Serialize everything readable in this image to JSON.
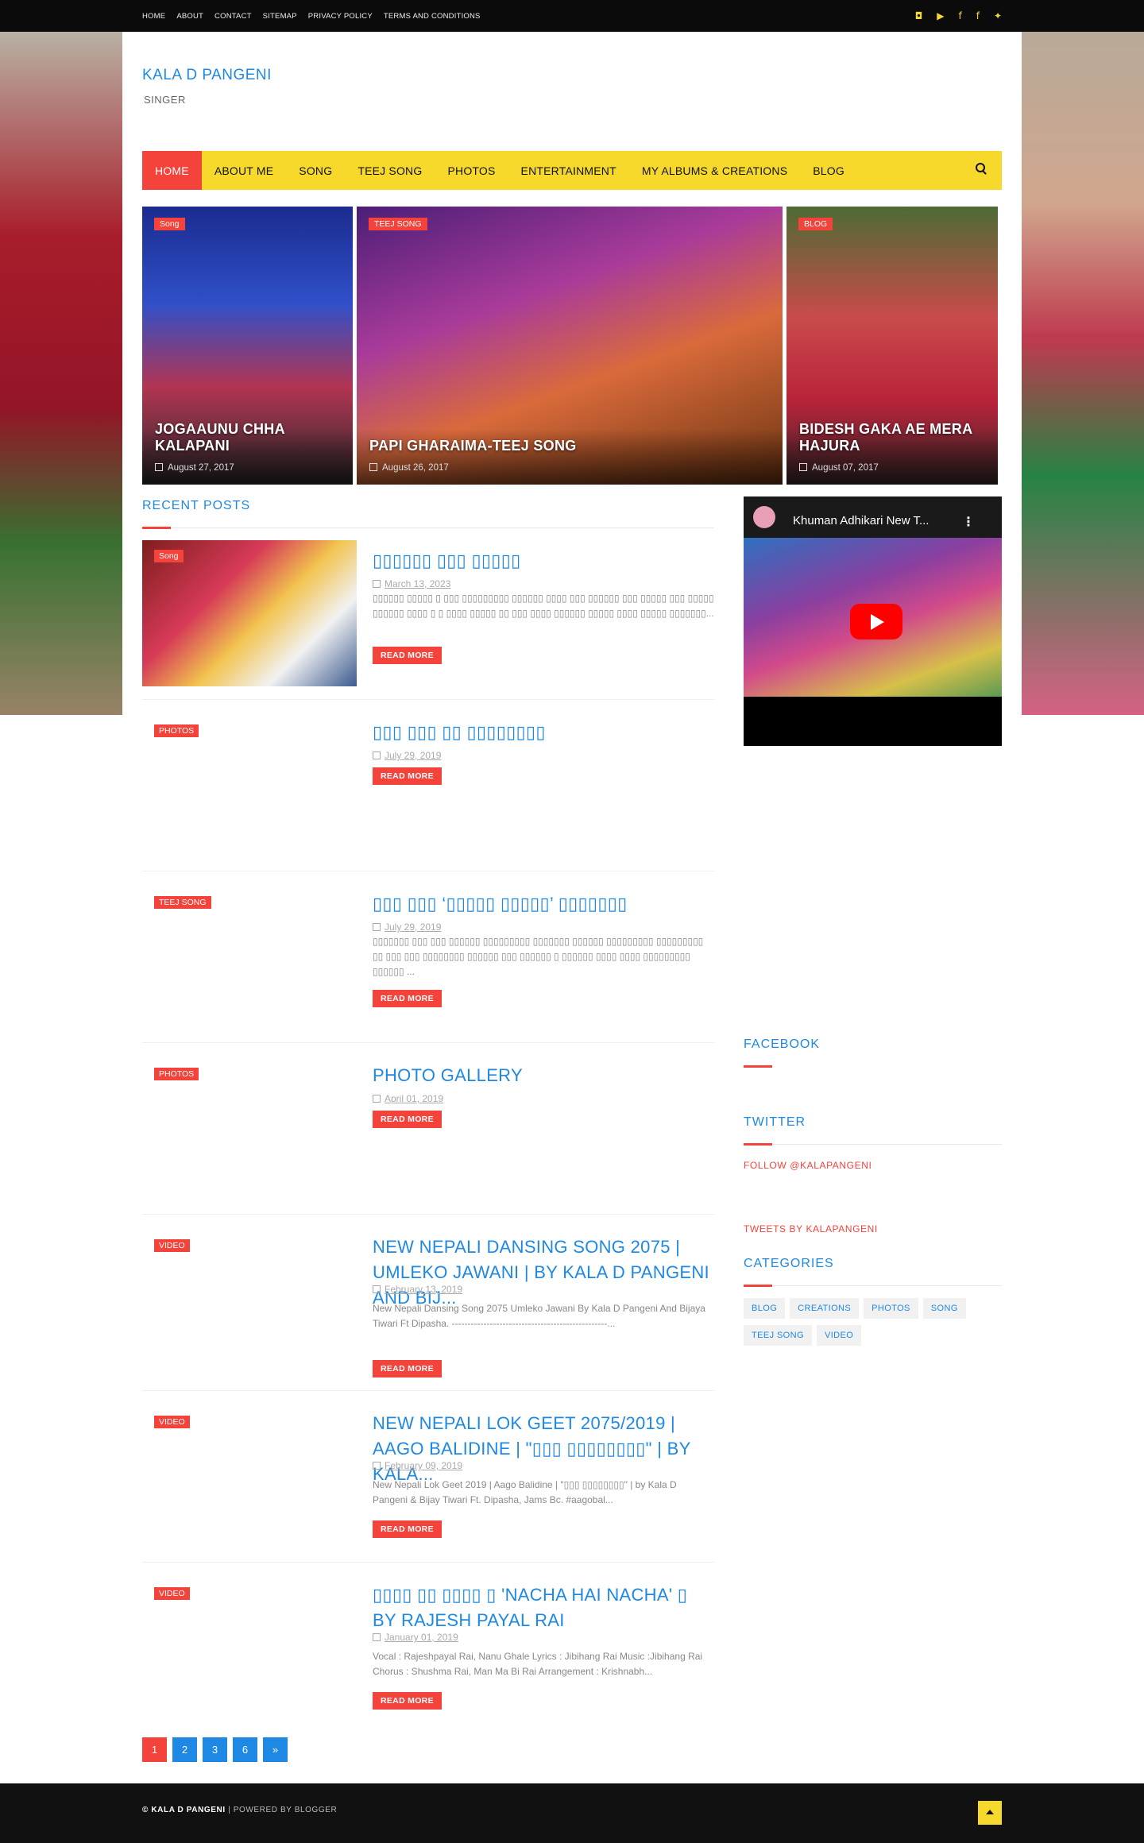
{
  "topnav": [
    "HOME",
    "ABOUT",
    "CONTACT",
    "SITEMAP",
    "PRIVACY POLICY",
    "TERMS AND CONDITIONS"
  ],
  "social_icons": [
    "instagram-icon",
    "youtube-icon",
    "facebook-icon",
    "facebook-icon",
    "twitter-icon"
  ],
  "site": {
    "title": "KALA D PANGENI",
    "tagline": "SINGER"
  },
  "mainnav": [
    "HOME",
    "ABOUT ME",
    "SONG",
    "TEEJ SONG",
    "PHOTOS",
    "ENTERTAINMENT",
    "MY ALBUMS & CREATIONS",
    "BLOG"
  ],
  "featured": [
    {
      "label": "Song",
      "title": "JOGAAUNU CHHA KALAPANI",
      "date": "August 27, 2017"
    },
    {
      "label": "TEEJ SONG",
      "title": "PAPI GHARAIMA-TEEJ SONG",
      "date": "August 26, 2017"
    },
    {
      "label": "BLOG",
      "title": "BIDESH GAKA AE MERA HAJURA",
      "date": "August 07, 2017"
    }
  ],
  "recent": {
    "heading": "RECENT POSTS",
    "posts": [
      {
        "label": "Song",
        "title": "▯▯▯▯▯▯ ▯▯▯ ▯▯▯▯▯",
        "date": "March 13, 2023",
        "excerpt": "▯▯▯▯▯▯ ▯▯▯▯▯ ▯ ▯▯▯ ▯▯▯▯▯▯▯▯▯ ▯▯▯▯▯▯ ▯▯▯▯ ▯▯▯ ▯▯▯▯▯▯ ▯▯▯ ▯▯▯▯▯ ▯▯▯ ▯▯▯▯▯ ▯▯▯▯▯▯ ▯▯▯▯ ▯ ▯ ▯▯▯▯ ▯▯▯▯▯ ▯▯ ▯▯▯ ▯▯▯▯ ▯▯▯▯▯▯ ▯▯▯▯▯ ▯▯▯▯ ▯▯▯▯▯ ▯▯▯▯▯▯▯...",
        "more": "READ MORE"
      },
      {
        "label": "PHOTOS",
        "title": "▯▯▯ ▯▯▯ ▯▯ ▯▯▯▯▯▯▯▯",
        "date": "July 29, 2019",
        "excerpt": "",
        "more": "READ MORE"
      },
      {
        "label": "TEEJ SONG",
        "title": "▯▯▯ ▯▯▯ ‘▯▯▯▯▯ ▯▯▯▯▯’ ▯▯▯▯▯▯▯",
        "date": "July 29, 2019",
        "excerpt": "▯▯▯▯▯▯▯ ▯▯▯ ▯▯▯ ▯▯▯▯▯▯ ▯▯▯▯▯▯▯▯▯ ▯▯▯▯▯▯▯ ▯▯▯▯▯▯ ▯▯▯▯▯▯▯▯▯ ▯▯▯▯▯▯▯▯▯ ▯▯ ▯▯▯ ▯▯▯ ▯▯▯▯▯▯▯▯ ▯▯▯▯▯▯ ▯▯▯ ▯▯▯▯▯▯ ▯ ▯▯▯▯▯▯ ▯▯▯▯ ▯▯▯▯ ▯▯▯▯▯▯▯▯▯ ▯▯▯▯▯▯ ...",
        "more": "READ MORE"
      },
      {
        "label": "PHOTOS",
        "title": "PHOTO GALLERY",
        "date": "April 01, 2019",
        "excerpt": "",
        "more": "READ MORE"
      },
      {
        "label": "VIDEO",
        "title": "NEW NEPALI DANSING SONG 2075 | UMLEKO JAWANI | BY KALA D PANGENI AND BIJ...",
        "date": "February 13, 2019",
        "excerpt": "New Nepali Dansing Song 2075 Umleko Jawani By Kala D Pangeni And Bijaya Tiwari Ft Dipasha. -------------------------------------------------...",
        "more": "READ MORE"
      },
      {
        "label": "VIDEO",
        "title": "NEW NEPALI LOK GEET 2075/2019 | AAGO BALIDINE | \"▯▯▯ ▯▯▯▯▯▯▯▯\" | BY KALA...",
        "date": "February 09, 2019",
        "excerpt": "New Nepali Lok Geet 2019 | Aago Balidine | \"▯▯▯ ▯▯▯▯▯▯▯▯\" | by Kala D Pangeni & Bijay Tiwari Ft. Dipasha, Jams Bc. #aagobal...",
        "more": "READ MORE"
      },
      {
        "label": "VIDEO",
        "title": "▯▯▯▯ ▯▯ ▯▯▯▯ ▯ 'NACHA HAI NACHA' ▯ BY RAJESH PAYAL RAI",
        "date": "January 01, 2019",
        "excerpt": "Vocal : Rajeshpayal Rai, Nanu Ghale Lyrics : Jibihang Rai Music :Jibihang Rai Chorus : Shushma Rai, Man Ma Bi Rai Arrangement : Krishnabh...",
        "more": "READ MORE"
      }
    ]
  },
  "video": {
    "title": "Khuman Adhikari New T..."
  },
  "sidebar": {
    "facebook_heading": "FACEBOOK",
    "twitter_heading": "TWITTER",
    "follow_link": "FOLLOW @KALAPANGENI",
    "tweets_link": "TWEETS BY KALAPANGENI",
    "categories_heading": "CATEGORIES",
    "categories": [
      "BLOG",
      "CREATIONS",
      "PHOTOS",
      "SONG",
      "TEEJ SONG",
      "VIDEO"
    ]
  },
  "pager": [
    "1",
    "2",
    "3",
    "6",
    "»"
  ],
  "footer": {
    "copyright": "© KALA D PANGENI",
    "powered": " | POWERED BY BLOGGER"
  }
}
